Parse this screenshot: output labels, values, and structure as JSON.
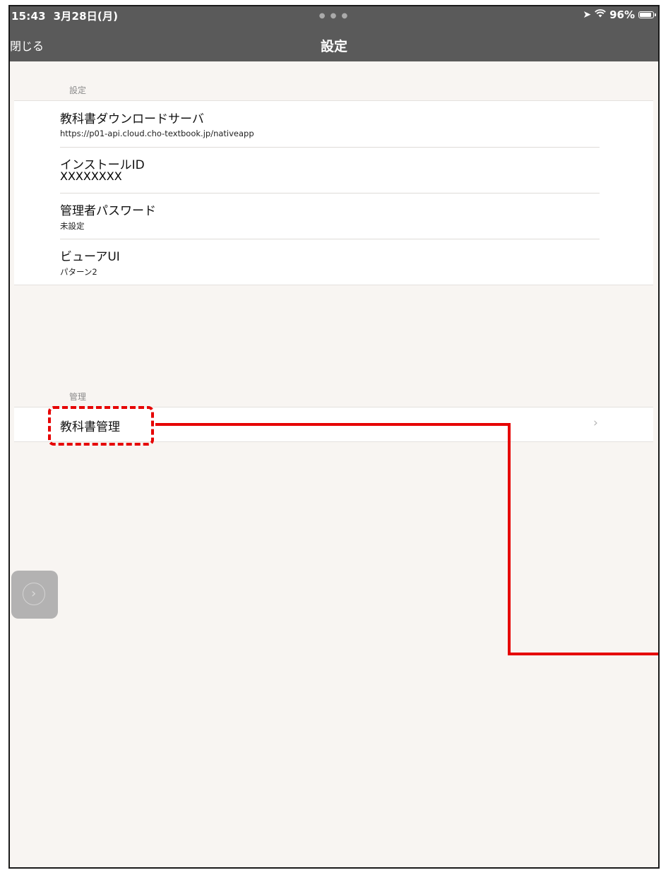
{
  "status_bar": {
    "time": "15:43",
    "date": "3月28日(月)",
    "battery": "96%",
    "icons": [
      "location-arrow-icon",
      "wifi-icon",
      "battery-icon"
    ]
  },
  "nav_bar": {
    "close_label": "閉じる",
    "title": "設定"
  },
  "sections": {
    "settings": {
      "header": "設定",
      "rows": [
        {
          "title": "教科書ダウンロードサーバ",
          "subtitle": "https://p01-api.cloud.cho-textbook.jp/nativeapp"
        },
        {
          "title": "インストールID",
          "subtitle": "XXXXXXXX"
        },
        {
          "title": "管理者パスワード",
          "subtitle": "未設定"
        },
        {
          "title": "ビューアUI",
          "subtitle": "パターン2"
        }
      ]
    },
    "management": {
      "header": "管理",
      "rows": [
        {
          "title": "教科書管理",
          "chevron": "chevron-right-icon"
        }
      ]
    }
  },
  "annotation": {
    "color": "#e60000",
    "style": "dashed-box-with-callout-line"
  },
  "floating_button": {
    "icon": "chevron-right-circle-icon"
  },
  "colors": {
    "bar_background": "#5a5a5a",
    "page_background": "#f8f5f2",
    "row_background": "#ffffff"
  }
}
